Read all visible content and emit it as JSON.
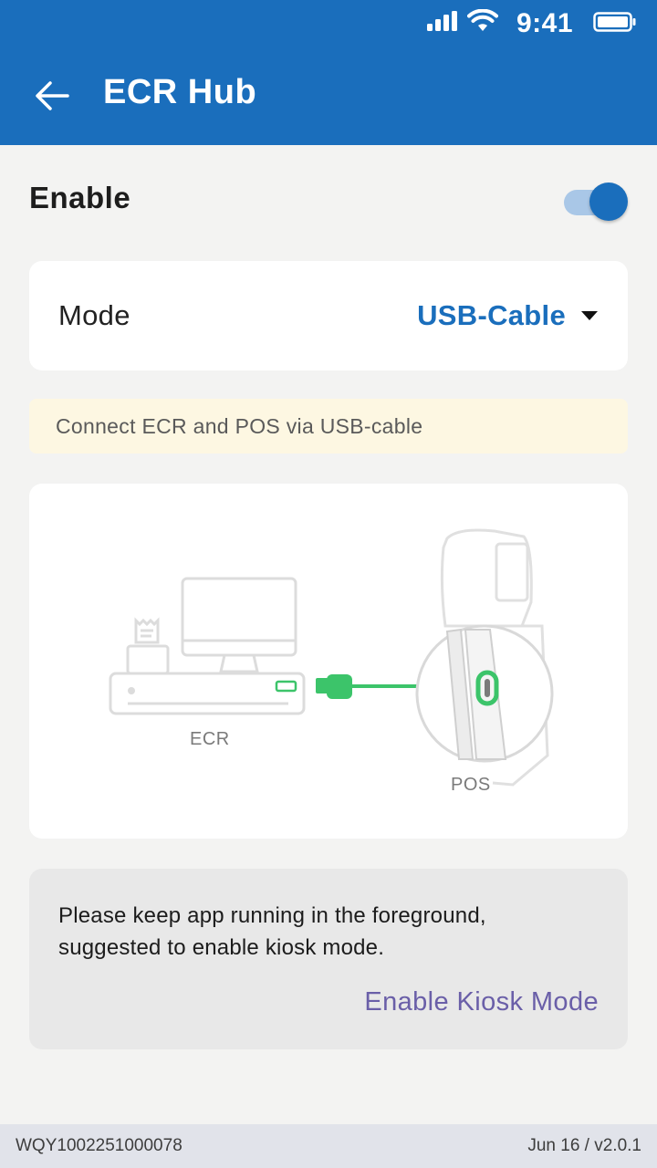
{
  "status_bar": {
    "time": "9:41"
  },
  "header": {
    "title": "ECR Hub",
    "back_icon": "arrow-left-icon"
  },
  "enable": {
    "label": "Enable",
    "enabled": true,
    "accent": "#1a6ebc"
  },
  "mode": {
    "label": "Mode",
    "value": "USB-Cable",
    "caret_icon": "caret-down-icon"
  },
  "hint": {
    "text": "Connect ECR and POS via USB-cable"
  },
  "illustration": {
    "ecr_label": "ECR",
    "pos_label": "POS",
    "cable_color": "#3cc46a"
  },
  "note": {
    "line1": "Please keep app running in the foreground,",
    "line2": "suggested to enable kiosk mode.",
    "action": "Enable Kiosk Mode"
  },
  "footer": {
    "serial": "WQY1002251000078",
    "version": "Jun 16 / v2.0.1"
  },
  "colors": {
    "app_bar": "#1a6ebc",
    "link": "#6a5fa8",
    "hint_bg": "#fdf7e2"
  }
}
